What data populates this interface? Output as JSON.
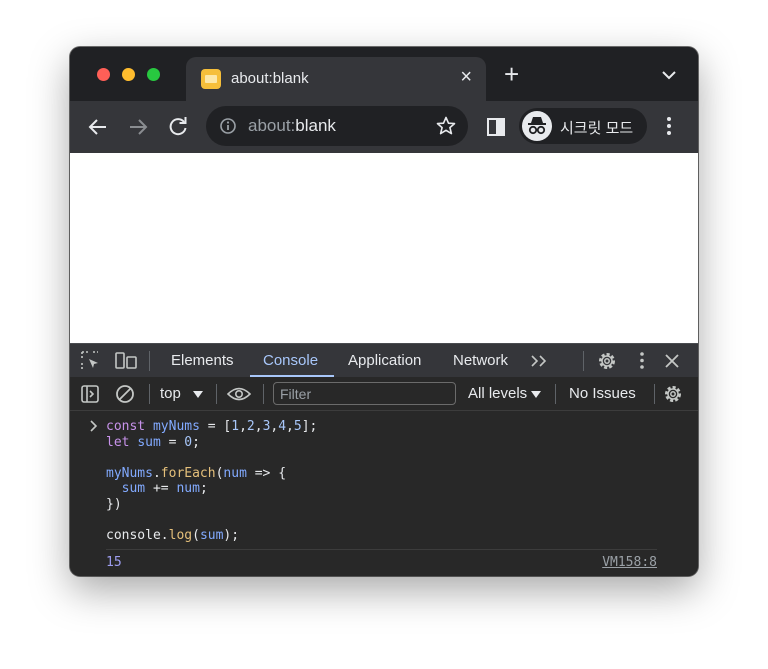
{
  "browser": {
    "tab": {
      "title": "about:blank",
      "favicon": "page-favicon-icon"
    },
    "new_tab_label": "+",
    "url": {
      "scheme": "about:",
      "host": "blank"
    },
    "incognito_label": "시크릿 모드"
  },
  "devtools": {
    "tabs": [
      {
        "label": "Elements"
      },
      {
        "label": "Console",
        "active": true
      },
      {
        "label": "Application"
      },
      {
        "label": "Network"
      }
    ],
    "console_toolbar": {
      "context": "top",
      "filter_placeholder": "Filter",
      "levels": "All levels",
      "issues": "No Issues"
    },
    "console": {
      "code_lines": [
        "const myNums = [1,2,3,4,5];",
        "let sum = 0;",
        "",
        "myNums.forEach(num => {",
        "  sum += num;",
        "})",
        "",
        "console.log(sum);"
      ],
      "result": "15",
      "source": "VM158:8"
    }
  },
  "colors": {
    "chrome_dark": "#202124",
    "toolbar": "#35363a",
    "devtools_bg": "#282828",
    "active_tab_accent": "#a8c7fa"
  }
}
